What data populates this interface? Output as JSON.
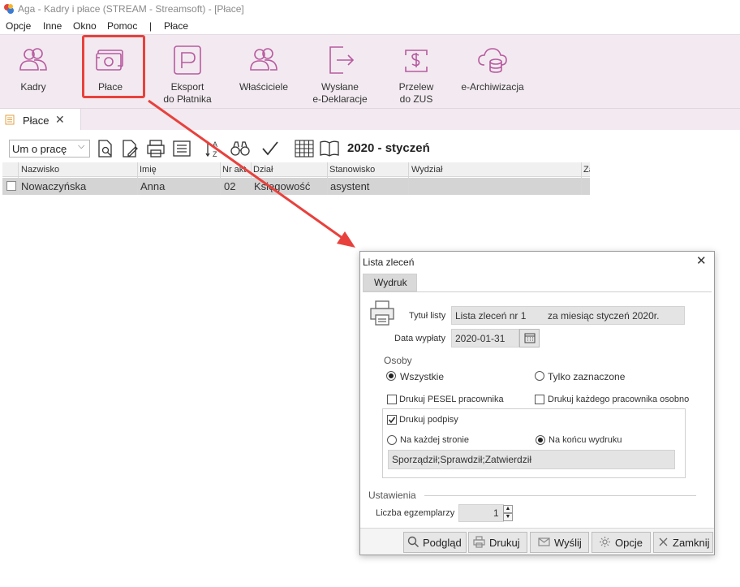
{
  "window": {
    "title": "Aga - Kadry i płace (STREAM - Streamsoft) - [Płace]"
  },
  "menu": {
    "items": [
      "Opcje",
      "Inne",
      "Okno",
      "Pomoc",
      "|",
      "Płace"
    ]
  },
  "ribbon": {
    "buttons": [
      {
        "label": "Kadry",
        "icon": "people-icon"
      },
      {
        "label": "Płace",
        "icon": "money-icon"
      },
      {
        "label": "Eksport\ndo Płatnika",
        "icon": "platnik-icon"
      },
      {
        "label": "Właściciele",
        "icon": "owners-icon"
      },
      {
        "label": "Wysłane\ne-Deklaracje",
        "icon": "export-icon"
      },
      {
        "label": "Przelew\ndo ZUS",
        "icon": "transfer-icon"
      },
      {
        "label": "e-Archiwizacja",
        "icon": "cloud-database-icon"
      }
    ]
  },
  "tab": {
    "label": "Płace",
    "close": "✕"
  },
  "toolbar": {
    "period_type": "Um o pracę",
    "period_label": "2020 - styczeń"
  },
  "grid": {
    "columns": [
      "Nazwisko",
      "Imię",
      "Nr akt",
      "Dział",
      "Stanowisko",
      "Wydział",
      "Za"
    ],
    "rows": [
      {
        "nazwisko": "Nowaczyńska",
        "imie": "Anna",
        "nr_akt": "02",
        "dzial": "Księgowość",
        "stanowisko": "asystent",
        "wydzial": ""
      }
    ]
  },
  "dialog": {
    "title": "Lista zleceń",
    "close": "✕",
    "tab": "Wydruk",
    "tytul_label": "Tytuł listy",
    "tytul_value": "Lista zleceń nr 1        za miesiąc styczeń 2020r.",
    "data_label": "Data wypłaty",
    "data_value": "2020-01-31",
    "osoby_title": "Osoby",
    "radio_all": "Wszystkie",
    "radio_selected": "Tylko zaznaczone",
    "chk_pesel": "Drukuj PESEL pracownika",
    "chk_each": "Drukuj każdego pracownika osobno",
    "chk_signatures": "Drukuj podpisy",
    "radio_each_page": "Na każdej stronie",
    "radio_end": "Na końcu wydruku",
    "signatures_value": "Sporządził;Sprawdził;Zatwierdził",
    "ustawienia_title": "Ustawienia",
    "copies_label": "Liczba egzemplarzy",
    "copies_value": "1",
    "buttons": {
      "preview": "Podgląd",
      "print": "Drukuj",
      "send": "Wyślij",
      "options": "Opcje",
      "close": "Zamknij"
    }
  },
  "colors": {
    "ribbon_bg": "#f2eaf0",
    "icon": "#b85aa0",
    "highlight": "#e8413d"
  }
}
